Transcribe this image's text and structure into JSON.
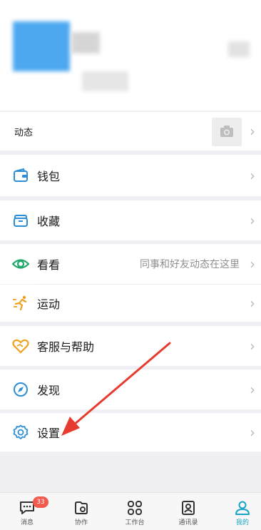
{
  "moments": {
    "label": "动态"
  },
  "menu": [
    {
      "id": "wallet",
      "label": "钱包",
      "icon": "wallet-icon"
    },
    {
      "id": "favorites",
      "label": "收藏",
      "icon": "folder-icon"
    },
    {
      "id": "look",
      "label": "看看",
      "hint": "同事和好友动态在这里",
      "icon": "eye-icon"
    },
    {
      "id": "sport",
      "label": "运动",
      "icon": "running-icon"
    },
    {
      "id": "support",
      "label": "客服与帮助",
      "icon": "heart-icon"
    },
    {
      "id": "discover",
      "label": "发现",
      "icon": "compass-icon"
    },
    {
      "id": "settings",
      "label": "设置",
      "icon": "gear-icon"
    }
  ],
  "tabs": [
    {
      "label": "消息",
      "badge": "33"
    },
    {
      "label": "协作"
    },
    {
      "label": "工作台"
    },
    {
      "label": "通讯录"
    },
    {
      "label": "我的"
    }
  ],
  "colors": {
    "accent": "#1aa3c4",
    "icon_blue": "#2b8fd8",
    "badge": "#f25a4d",
    "arrow": "#e63b2e"
  }
}
